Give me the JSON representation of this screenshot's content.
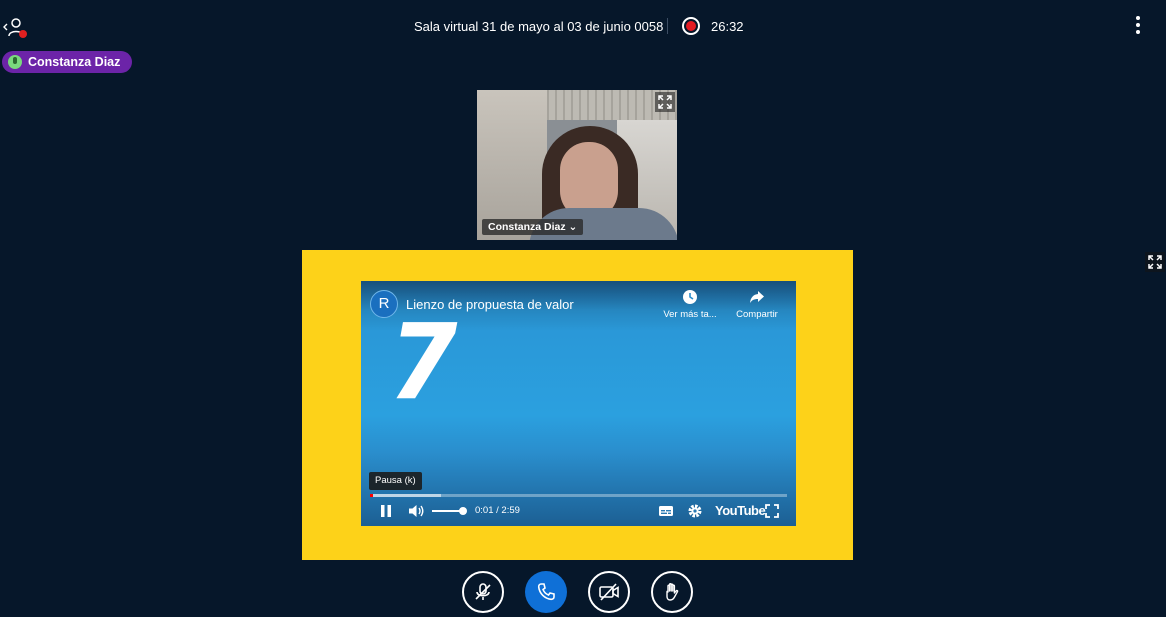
{
  "header": {
    "room_title": "Sala virtual 31 de mayo al 03 de junio 0058",
    "recording_time": "26:32"
  },
  "talking_indicator": {
    "name": "Constanza Diaz"
  },
  "webcam": {
    "participant_name": "Constanza Diaz ⌄"
  },
  "video": {
    "avatar_letter": "R",
    "title": "Lienzo de propuesta de valor",
    "watch_later_label": "Ver más ta...",
    "share_label": "Compartir",
    "big_number": "7",
    "tooltip": "Pausa (k)",
    "time": "0:01 / 2:59",
    "brand": "YouTube",
    "progress_fraction": 0.006,
    "buffer_fraction": 0.17,
    "volume_fraction": 0.9
  },
  "colors": {
    "background": "#06172a",
    "talker_badge": "#6c24a8",
    "presentation_bg": "#fdd219",
    "recording": "#e31b23",
    "primary": "#0f70d7"
  },
  "icons": {
    "user_list": "user-list-icon",
    "options": "vertical-dots-icon",
    "mic_muted": "mic-muted-icon",
    "phone": "phone-icon",
    "camera_off": "camera-off-icon",
    "raise_hand": "hand-icon",
    "expand": "fullscreen-icon"
  }
}
